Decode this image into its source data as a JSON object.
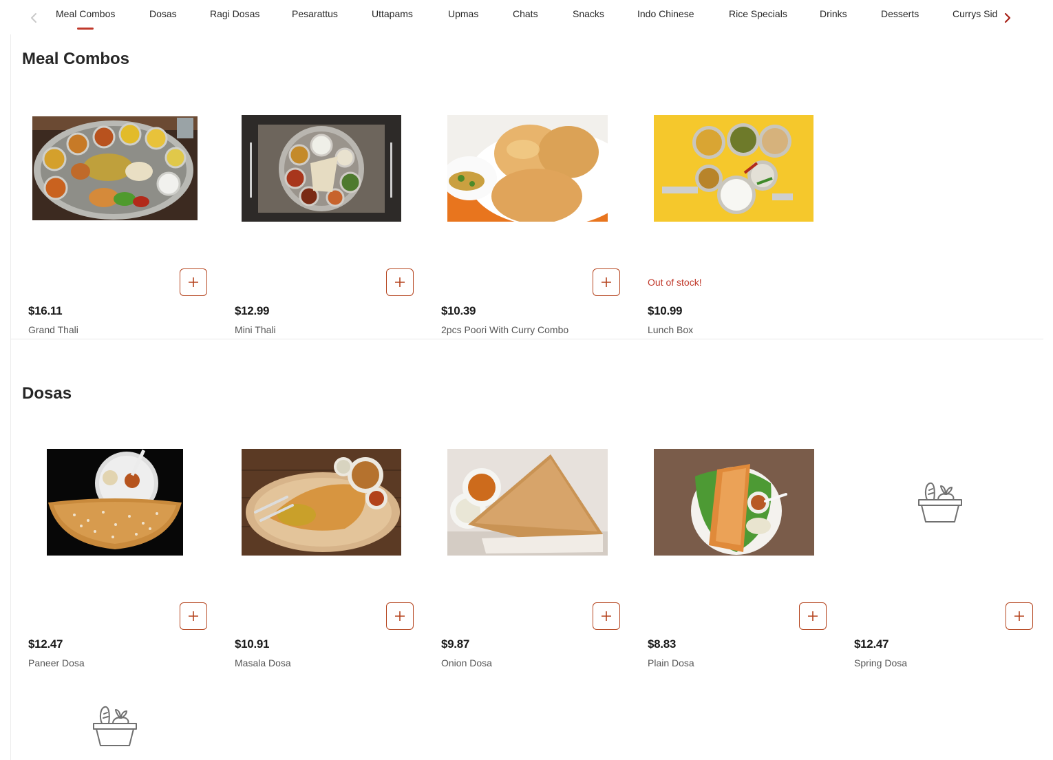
{
  "tabs": {
    "prev_icon": "chevron-left-icon",
    "next_icon": "chevron-right-icon",
    "items": [
      "Meal Combos",
      "Dosas",
      "Ragi Dosas",
      "Pesarattus",
      "Uttapams",
      "Upmas",
      "Chats",
      "Snacks",
      "Indo Chinese",
      "Rice Specials",
      "Drinks",
      "Desserts",
      "Currys Sides"
    ],
    "active": "Meal Combos"
  },
  "colors": {
    "accent": "#c0392b",
    "button_border": "#b5441e",
    "text": "#191919",
    "muted": "#555555"
  },
  "sections": [
    {
      "title": "Meal Combos",
      "items": [
        {
          "price": "$16.11",
          "name": "Grand Thali",
          "image": "thali-photo",
          "out_of_stock": false
        },
        {
          "price": "$12.99",
          "name": "Mini Thali",
          "image": "mini-thali-photo",
          "out_of_stock": false
        },
        {
          "price": "$10.39",
          "name": "2pcs Poori With Curry Combo",
          "image": "poori-photo",
          "out_of_stock": false
        },
        {
          "price": "$10.99",
          "name": "Lunch Box",
          "image": "lunch-box-photo",
          "out_of_stock": true,
          "status": "Out of stock!"
        }
      ]
    },
    {
      "title": "Dosas",
      "items": [
        {
          "price": "$12.47",
          "name": "Paneer Dosa",
          "image": "paneer-dosa-photo",
          "out_of_stock": false
        },
        {
          "price": "$10.91",
          "name": "Masala Dosa",
          "image": "masala-dosa-photo",
          "out_of_stock": false
        },
        {
          "price": "$9.87",
          "name": "Onion Dosa",
          "image": "onion-dosa-photo",
          "out_of_stock": false
        },
        {
          "price": "$8.83",
          "name": "Plain Dosa",
          "image": "plain-dosa-photo",
          "out_of_stock": false
        },
        {
          "price": "$12.47",
          "name": "Spring Dosa",
          "image": "grocery-basket-icon",
          "out_of_stock": false
        }
      ]
    }
  ]
}
